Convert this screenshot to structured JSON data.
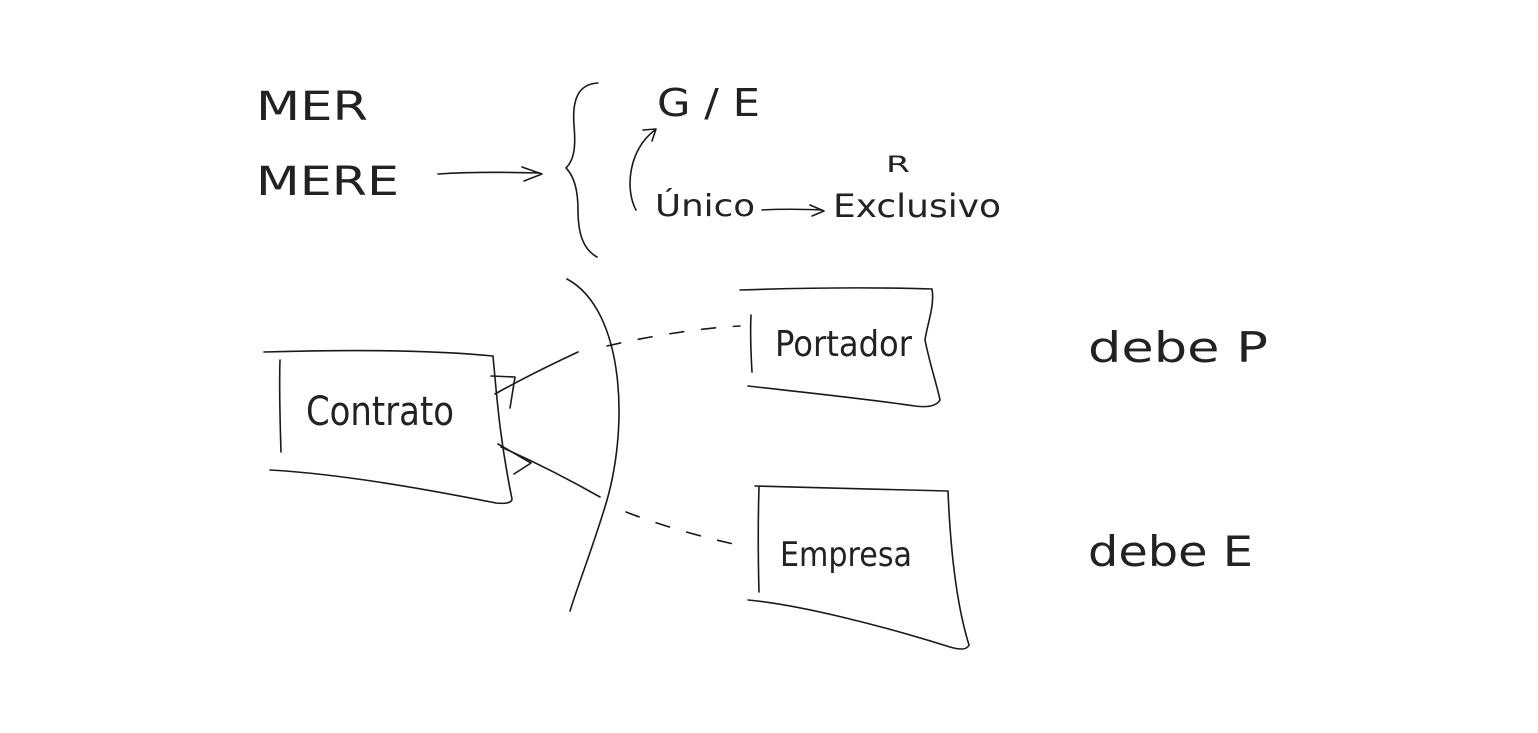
{
  "notes": {
    "mer": "MER",
    "mere": "MERE",
    "ge": "G / E",
    "r": "R",
    "unico": "Único",
    "exclusivo": "Exclusivo"
  },
  "entities": {
    "contrato": "Contrato",
    "portador": "Portador",
    "empresa": "Empresa"
  },
  "side_notes": {
    "debe_p": "debe  P",
    "debe_e": "debe  E"
  },
  "colors": {
    "ink": "#1a1a1a",
    "background": "#ffffff"
  }
}
